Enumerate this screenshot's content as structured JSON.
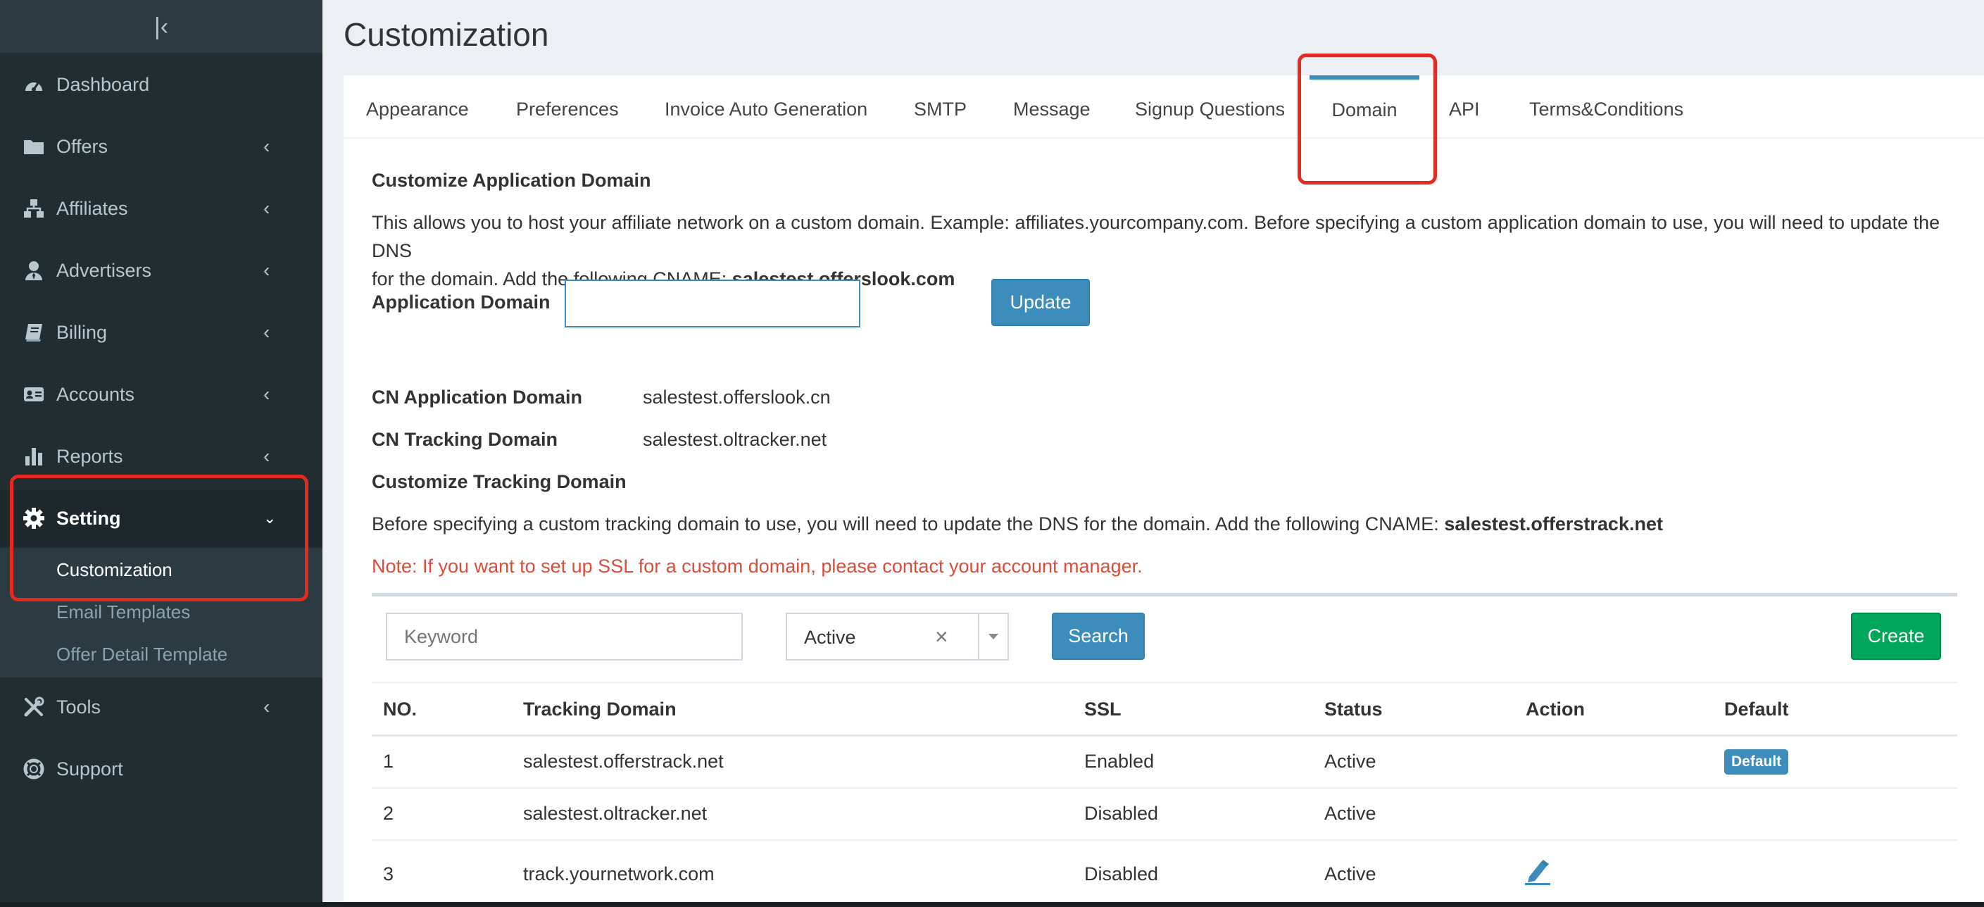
{
  "sidebar": {
    "collapse_glyph": "|‹",
    "items": [
      {
        "label": "Dashboard",
        "icon": "dashboard-icon"
      },
      {
        "label": "Offers",
        "icon": "folder-icon"
      },
      {
        "label": "Affiliates",
        "icon": "sitemap-icon"
      },
      {
        "label": "Advertisers",
        "icon": "user-tie-icon"
      },
      {
        "label": "Billing",
        "icon": "book-icon"
      },
      {
        "label": "Accounts",
        "icon": "id-card-icon"
      },
      {
        "label": "Reports",
        "icon": "bar-chart-icon"
      },
      {
        "label": "Setting",
        "icon": "gear-icon"
      },
      {
        "label": "Tools",
        "icon": "tools-icon"
      },
      {
        "label": "Support",
        "icon": "life-ring-icon"
      }
    ],
    "setting_sub": [
      {
        "label": "Customization"
      },
      {
        "label": "Email Templates"
      },
      {
        "label": "Offer Detail Template"
      }
    ]
  },
  "page": {
    "title": "Customization"
  },
  "tabs": [
    {
      "label": "Appearance"
    },
    {
      "label": "Preferences"
    },
    {
      "label": "Invoice Auto Generation"
    },
    {
      "label": "SMTP"
    },
    {
      "label": "Message"
    },
    {
      "label": "Signup Questions"
    },
    {
      "label": "Domain"
    },
    {
      "label": "API"
    },
    {
      "label": "Terms&Conditions"
    }
  ],
  "app_domain": {
    "heading": "Customize Application Domain",
    "desc_line1": "This allows you to host your affiliate network on a custom domain. Example: affiliates.yourcompany.com. Before specifying a custom application domain to use, you will need to update the DNS",
    "desc_line2": "for the domain. Add the following CNAME: ",
    "cname": "salestest.offerslook.com",
    "field_label": "Application Domain",
    "field_value": "",
    "update_label": "Update"
  },
  "cn": {
    "app_label": "CN Application Domain",
    "app_value": "salestest.offerslook.cn",
    "tracking_label": "CN Tracking Domain",
    "tracking_value": "salestest.oltracker.net"
  },
  "tracking": {
    "heading": "Customize Tracking Domain",
    "desc": "Before specifying a custom tracking domain to use, you will need to update the DNS for the domain. Add the following CNAME: ",
    "cname": "salestest.offerstrack.net",
    "note": "Note: If you want to set up SSL for a custom domain, please contact your account manager."
  },
  "filters": {
    "keyword_placeholder": "Keyword",
    "status_value": "Active",
    "clear_glyph": "×",
    "search_label": "Search",
    "create_label": "Create"
  },
  "table": {
    "headers": [
      "NO.",
      "Tracking Domain",
      "SSL",
      "Status",
      "Action",
      "Default"
    ],
    "rows": [
      {
        "no": "1",
        "domain": "salestest.offerstrack.net",
        "ssl": "Enabled",
        "status": "Active",
        "default": "Default"
      },
      {
        "no": "2",
        "domain": "salestest.oltracker.net",
        "ssl": "Disabled",
        "status": "Active",
        "default": ""
      },
      {
        "no": "3",
        "domain": "track.yournetwork.com",
        "ssl": "Disabled",
        "status": "Active",
        "default": ""
      }
    ]
  },
  "colors": {
    "accent": "#3c8dbc",
    "success": "#00a65a",
    "danger": "#dd4b39",
    "sidebar": "#222d32",
    "highlight": "#e32b22"
  }
}
